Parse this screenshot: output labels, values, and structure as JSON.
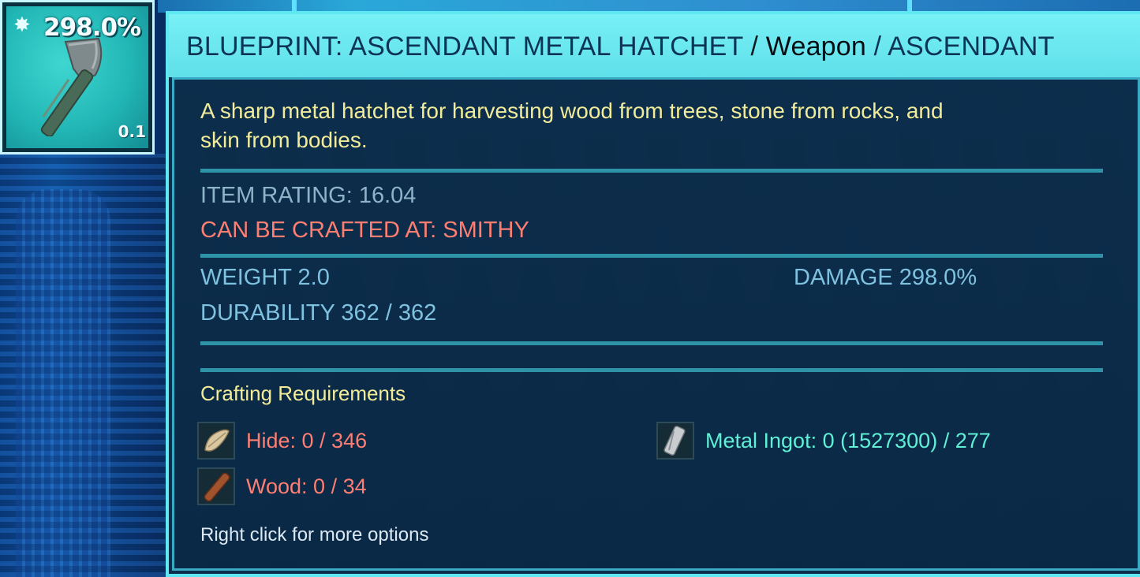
{
  "item_slot": {
    "damage_percent": "298.0%",
    "weight": "0.1",
    "star_glyph": "✸",
    "icon": "metal-hatchet-icon"
  },
  "tooltip": {
    "title_main": "BLUEPRINT: ASCENDANT METAL HATCHET",
    "title_sep1": " / ",
    "title_type": "Weapon",
    "title_sep2": " / ",
    "title_quality": "ASCENDANT",
    "description": "A sharp metal hatchet for harvesting wood from trees, stone from rocks, and skin from bodies.",
    "item_rating": "ITEM RATING: 16.04",
    "crafted_at": "CAN BE CRAFTED AT: SMITHY",
    "weight": "WEIGHT 2.0",
    "damage": "DAMAGE 298.0%",
    "durability": "DURABILITY 362 / 362",
    "crafting_title": "Crafting Requirements",
    "requirements": [
      {
        "label": "Hide: 0 / 346",
        "icon": "hide-icon",
        "status_color": "#ff7e72"
      },
      {
        "label": "Wood: 0 / 34",
        "icon": "wood-icon",
        "status_color": "#ff7e72"
      },
      {
        "label": "Metal Ingot: 0 (1527300) / 277",
        "icon": "metal-ingot-icon",
        "status_color": "#5ff0d6"
      }
    ],
    "footer_hint": "Right click for more options"
  },
  "colors": {
    "accent": "#5fe7f2",
    "description_text": "#f2ec9a",
    "missing_resource": "#ff7e72",
    "available_resource": "#5ff0d6"
  }
}
